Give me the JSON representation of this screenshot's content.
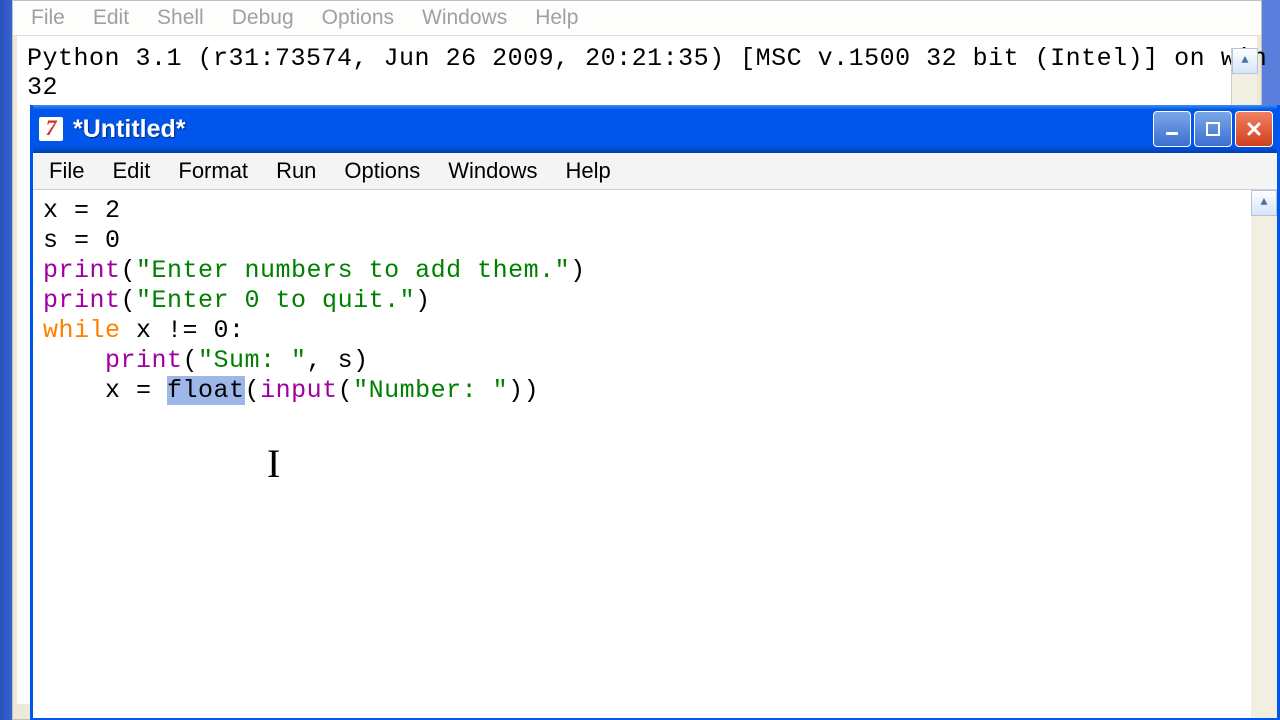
{
  "shell": {
    "menu": {
      "file": "File",
      "edit": "Edit",
      "shell": "Shell",
      "debug": "Debug",
      "options": "Options",
      "windows": "Windows",
      "help": "Help"
    },
    "banner": "Python 3.1 (r31:73574, Jun 26 2009, 20:21:35) [MSC v.1500 32 bit (Intel)] on win\n32"
  },
  "editor": {
    "title": "*Untitled*",
    "menu": {
      "file": "File",
      "edit": "Edit",
      "format": "Format",
      "run": "Run",
      "options": "Options",
      "windows": "Windows",
      "help": "Help"
    },
    "code": {
      "l1_a": "x = 2",
      "l2_a": "s = 0",
      "l3_print": "print",
      "l3_paren_open": "(",
      "l3_str": "\"Enter numbers to add them.\"",
      "l3_paren_close": ")",
      "l4_print": "print",
      "l4_paren_open": "(",
      "l4_str": "\"Enter 0 to quit.\"",
      "l4_paren_close": ")",
      "l5_while": "while",
      "l5_rest": " x != 0:",
      "l6_indent": "    ",
      "l6_print": "print",
      "l6_paren_open": "(",
      "l6_str": "\"Sum: \"",
      "l6_rest": ", s)",
      "l7_indent": "    x = ",
      "l7_float": "float",
      "l7_paren_open": "(",
      "l7_input": "input",
      "l7_paren2_open": "(",
      "l7_str": "\"Number: \"",
      "l7_rest": "))"
    },
    "selected_token": "float"
  },
  "colors": {
    "titlebar_blue": "#0055ea",
    "close_red": "#d04020",
    "keyword": "#ff8000",
    "builtin": "#a000a0",
    "string": "#008000",
    "selection": "#9cb7e8"
  }
}
